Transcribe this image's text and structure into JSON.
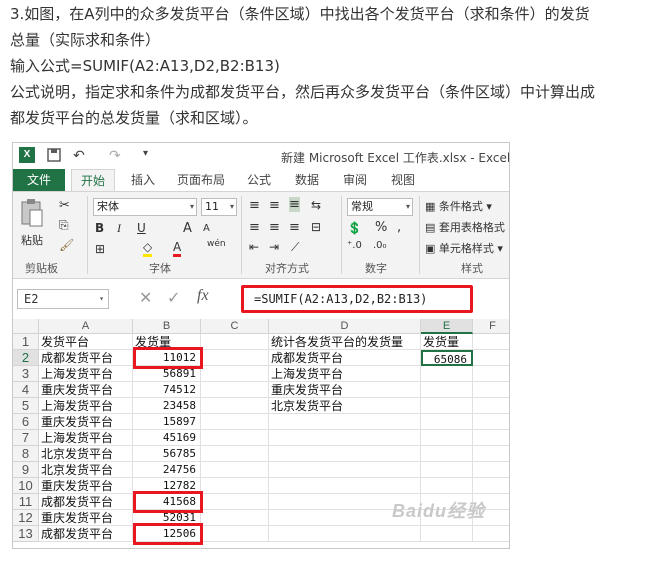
{
  "article": {
    "line1": "3.如图，在A列中的众多发货平台（条件区域）中找出各个发货平台（求和条件）的发货",
    "line2": "总量（实际求和条件）",
    "line3": "输入公式=SUMIF(A2:A13,D2,B2:B13)",
    "line4": "公式说明，指定求和条件为成都发货平台，然后再众多发货平台（条件区域）中计算出成",
    "line5": "都发货平台的总发货量（求和区域）。"
  },
  "window": {
    "title": "新建 Microsoft Excel 工作表.xlsx - Excel",
    "logo": "X"
  },
  "tabs": [
    "文件",
    "开始",
    "插入",
    "页面布局",
    "公式",
    "数据",
    "审阅",
    "视图"
  ],
  "ribbon": {
    "paste_label": "粘贴",
    "clipboard_label": "剪贴板",
    "font_name": "宋体",
    "font_size": "11",
    "font_label": "字体",
    "bold": "B",
    "italic": "I",
    "underline": "U",
    "grow_font": "A",
    "shrink_font": "A",
    "wen": "wén",
    "align_label": "对齐方式",
    "number_format": "常规",
    "number_label": "数字",
    "percent": "%",
    "comma": ",",
    "cond_format": "条件格式",
    "table_format": "套用表格格式",
    "cell_style": "单元格样式",
    "styles_label": "样式"
  },
  "formula_bar": {
    "name_box": "E2",
    "formula": "=SUMIF(A2:A13,D2,B2:B13)",
    "fx": "fx"
  },
  "grid": {
    "columns": [
      "A",
      "B",
      "C",
      "D",
      "E",
      "F"
    ],
    "rows": [
      {
        "n": "1",
        "a": "发货平台",
        "b": "发货量",
        "d": "统计各发货平台的发货量",
        "e": "发货量"
      },
      {
        "n": "2",
        "a": "成都发货平台",
        "b": "11012",
        "d": "成都发货平台",
        "e": "65086"
      },
      {
        "n": "3",
        "a": "上海发货平台",
        "b": "56891",
        "d": "上海发货平台",
        "e": ""
      },
      {
        "n": "4",
        "a": "重庆发货平台",
        "b": "74512",
        "d": "重庆发货平台",
        "e": ""
      },
      {
        "n": "5",
        "a": "上海发货平台",
        "b": "23458",
        "d": "北京发货平台",
        "e": ""
      },
      {
        "n": "6",
        "a": "重庆发货平台",
        "b": "15897",
        "d": "",
        "e": ""
      },
      {
        "n": "7",
        "a": "上海发货平台",
        "b": "45169",
        "d": "",
        "e": ""
      },
      {
        "n": "8",
        "a": "北京发货平台",
        "b": "56785",
        "d": "",
        "e": ""
      },
      {
        "n": "9",
        "a": "北京发货平台",
        "b": "24756",
        "d": "",
        "e": ""
      },
      {
        "n": "10",
        "a": "重庆发货平台",
        "b": "12782",
        "d": "",
        "e": ""
      },
      {
        "n": "11",
        "a": "成都发货平台",
        "b": "41568",
        "d": "",
        "e": ""
      },
      {
        "n": "12",
        "a": "重庆发货平台",
        "b": "52031",
        "d": "",
        "e": ""
      },
      {
        "n": "13",
        "a": "成都发货平台",
        "b": "12506",
        "d": "",
        "e": ""
      }
    ]
  },
  "watermark": "Baidu经验",
  "colors": {
    "excel_green": "#217346",
    "highlight_red": "#e8171f"
  }
}
